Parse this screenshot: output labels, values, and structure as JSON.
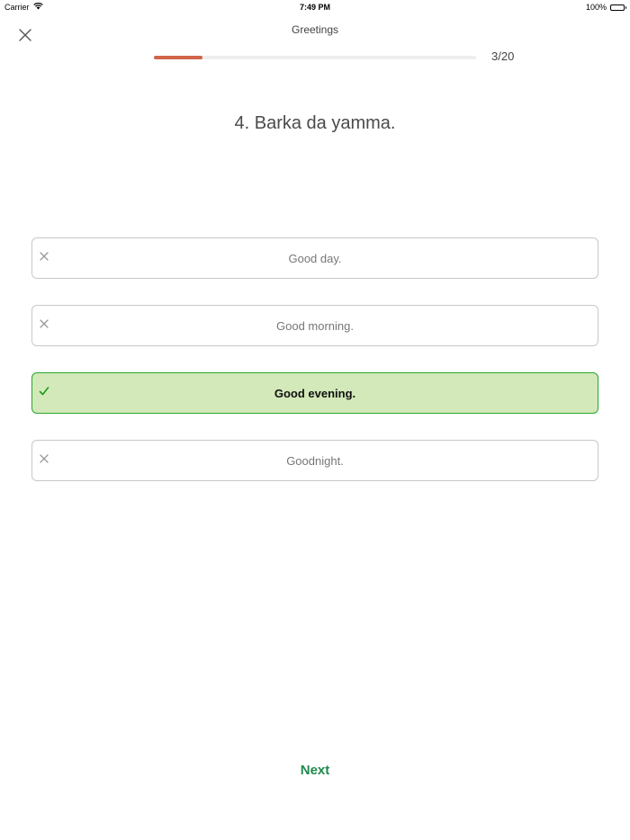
{
  "status_bar": {
    "carrier": "Carrier",
    "time": "7:49 PM",
    "battery_percent": "100%",
    "icons": [
      "wifi-icon",
      "battery-icon"
    ]
  },
  "header": {
    "title": "Greetings",
    "close_icon": "close-icon"
  },
  "progress": {
    "current": 3,
    "total": 20,
    "label": "3/20",
    "fraction": 0.15,
    "fill_color": "#d0654a"
  },
  "question": {
    "text": "4. Barka da yamma."
  },
  "options": [
    {
      "label": "Good day.",
      "state": "incorrect",
      "icon": "cross-icon"
    },
    {
      "label": "Good morning.",
      "state": "incorrect",
      "icon": "cross-icon"
    },
    {
      "label": "Good evening.",
      "state": "correct",
      "icon": "check-icon"
    },
    {
      "label": "Goodnight.",
      "state": "incorrect",
      "icon": "cross-icon"
    }
  ],
  "colors": {
    "correct_bg": "#d3e9ba",
    "correct_border": "#2aa52a",
    "accent_green": "#1e8a4c"
  },
  "footer": {
    "next_label": "Next"
  }
}
